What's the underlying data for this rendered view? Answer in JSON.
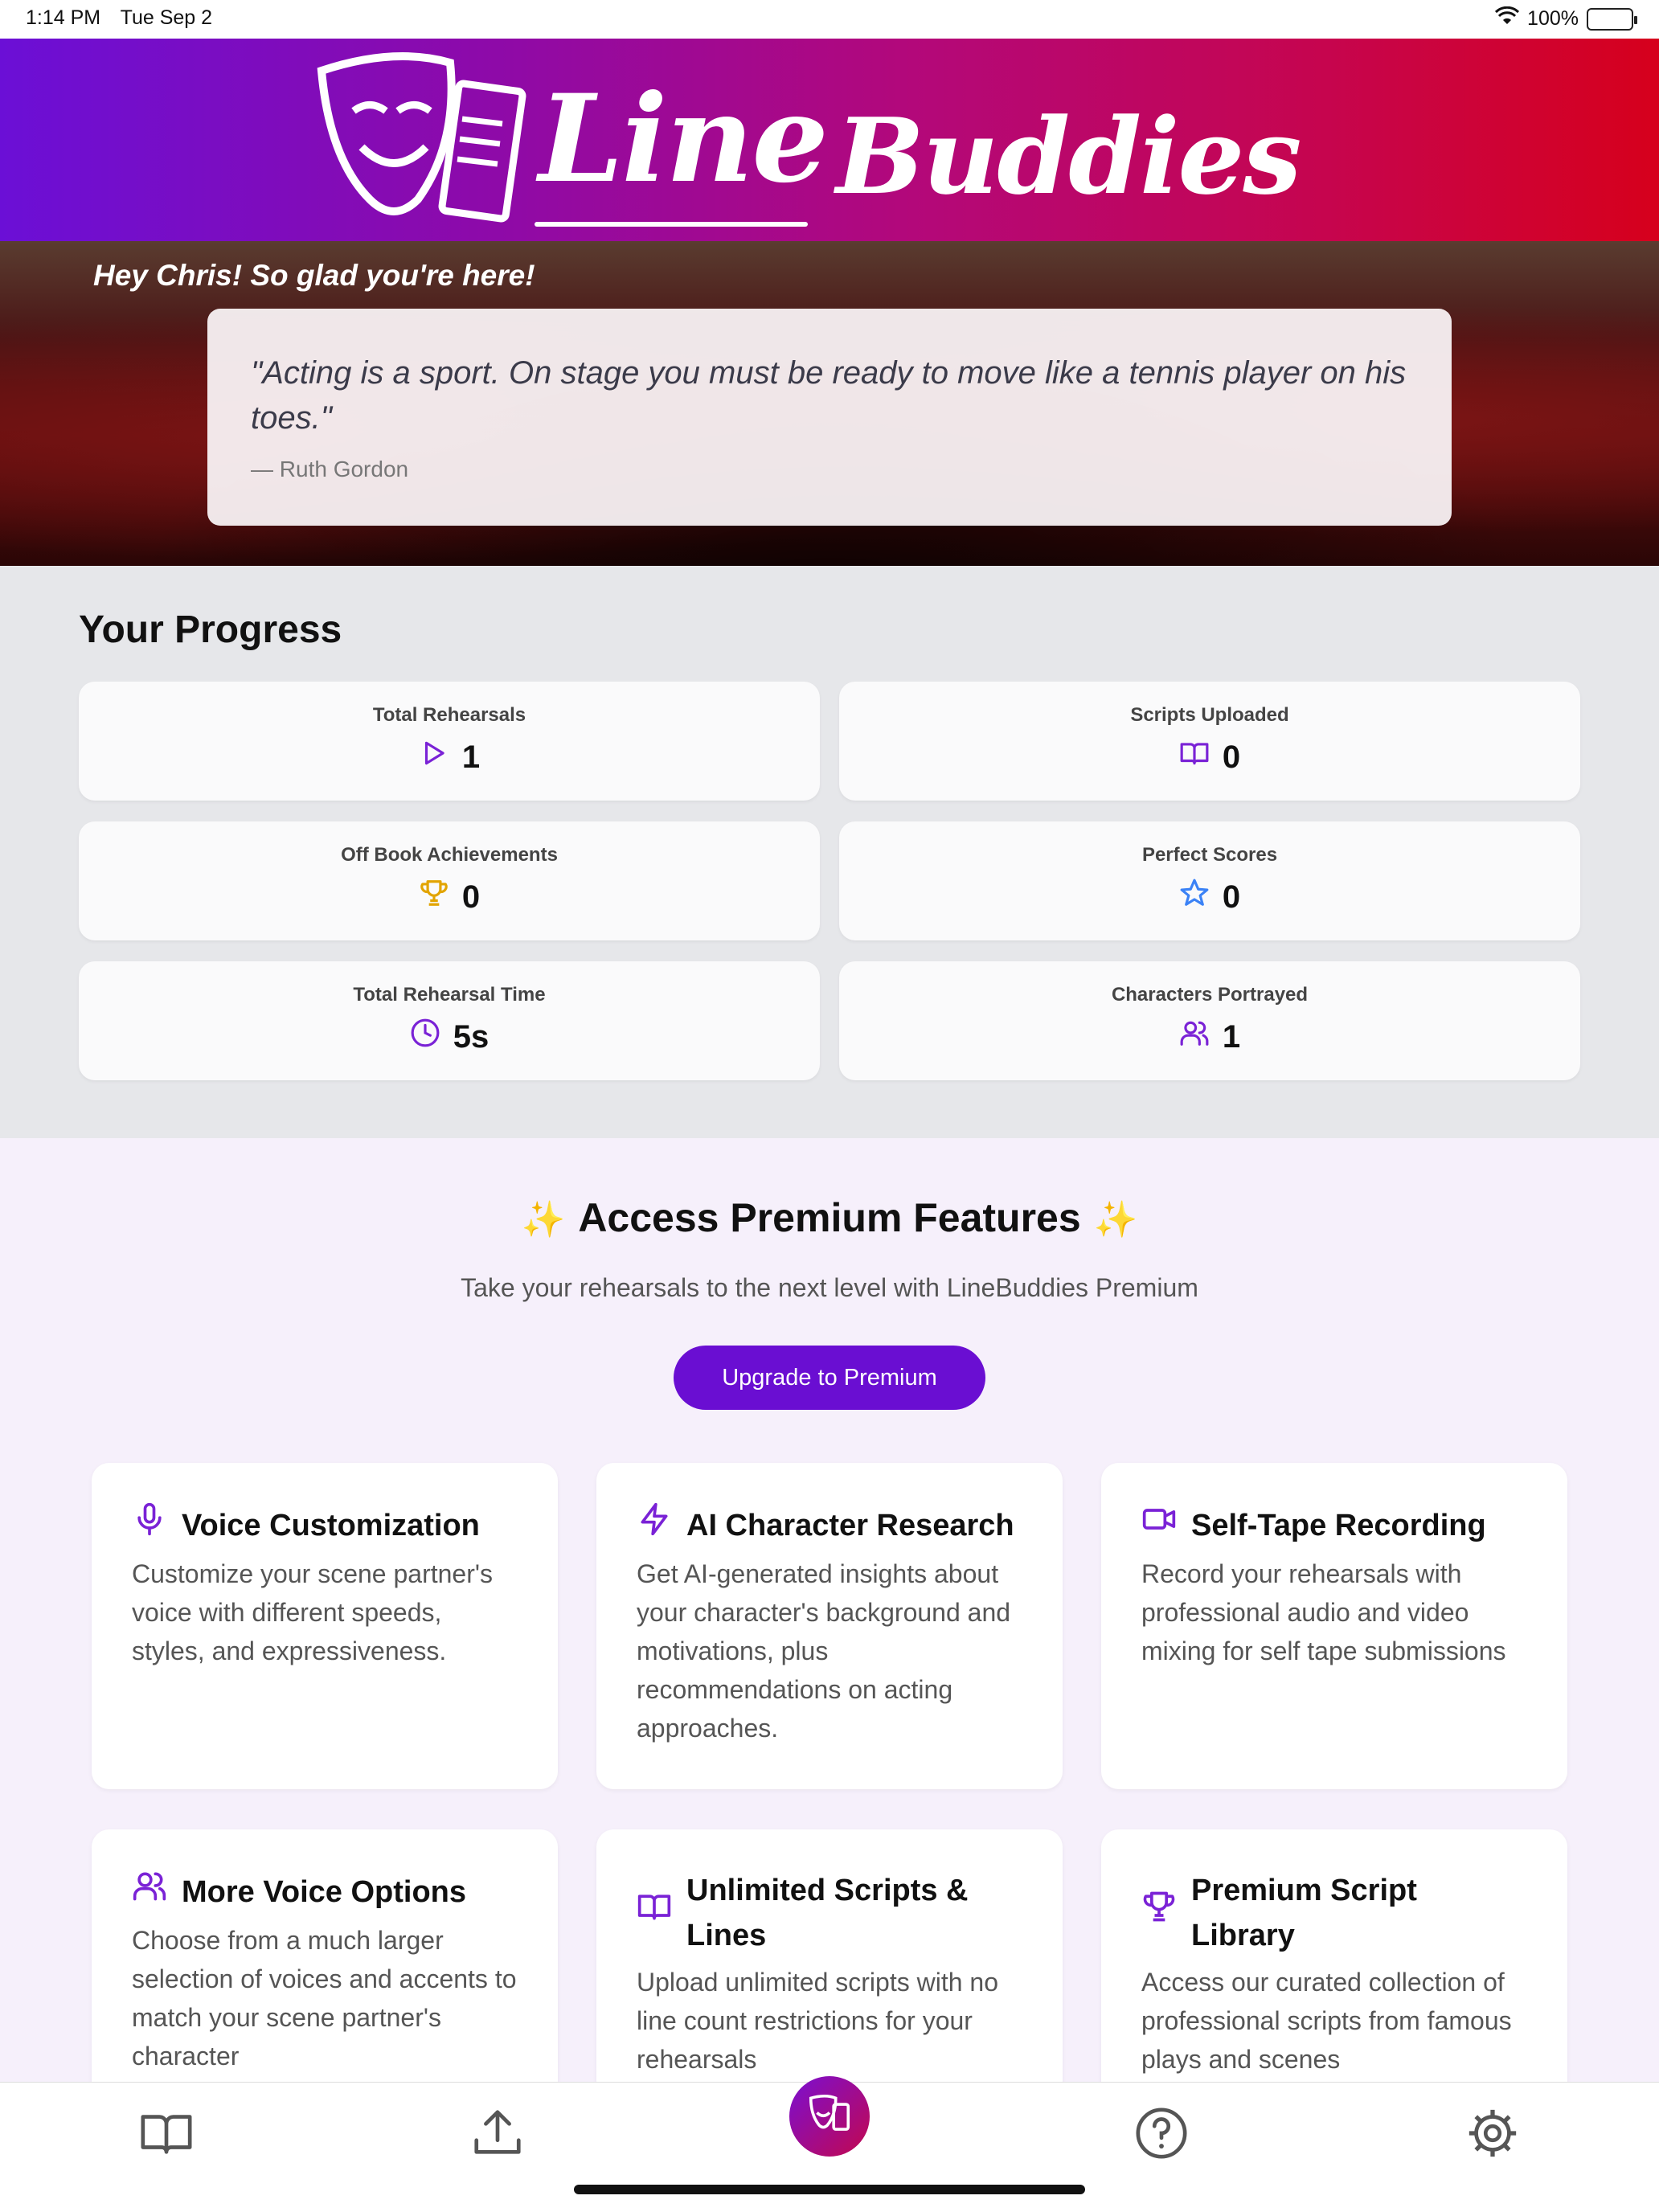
{
  "status_bar": {
    "time": "1:14 PM",
    "date": "Tue Sep 2",
    "battery": "100%"
  },
  "brand": {
    "logo_line": "Line",
    "logo_buddies": "Buddies",
    "gradient_start": "#6b0fd6",
    "gradient_end": "#d6001c"
  },
  "hero": {
    "greeting": "Hey Chris! So glad you're here!",
    "quote": "\"Acting is a sport. On stage you must be ready to move like a tennis player on his toes.\"",
    "author": "— Ruth Gordon"
  },
  "progress": {
    "title": "Your Progress",
    "stats": [
      {
        "label": "Total Rehearsals",
        "value": "1",
        "icon": "play-icon"
      },
      {
        "label": "Scripts Uploaded",
        "value": "0",
        "icon": "book-icon"
      },
      {
        "label": "Off Book Achievements",
        "value": "0",
        "icon": "trophy-icon"
      },
      {
        "label": "Perfect Scores",
        "value": "0",
        "icon": "star-icon"
      },
      {
        "label": "Total Rehearsal Time",
        "value": "5s",
        "icon": "clock-icon"
      },
      {
        "label": "Characters Portrayed",
        "value": "1",
        "icon": "users-icon"
      }
    ]
  },
  "premium": {
    "title": "Access Premium Features",
    "sparkle": "✨",
    "subtitle": "Take your rehearsals to the next level with LineBuddies Premium",
    "button": "Upgrade to Premium",
    "accent": "#6a0ed2",
    "features": [
      {
        "title": "Voice Customization",
        "desc": "Customize your scene partner's voice with different speeds, styles, and expressiveness.",
        "icon": "microphone-icon"
      },
      {
        "title": "AI Character Research",
        "desc": "Get AI-generated insights about your character's background and motivations, plus recommendations on acting approaches.",
        "icon": "lightning-icon"
      },
      {
        "title": "Self-Tape Recording",
        "desc": "Record your rehearsals with professional audio and video mixing for self tape submissions",
        "icon": "video-camera-icon"
      },
      {
        "title": "More Voice Options",
        "desc": "Choose from a much larger selection of voices and accents to match your scene partner's character",
        "icon": "users-icon"
      },
      {
        "title": "Unlimited Scripts & Lines",
        "desc": "Upload unlimited scripts with no line count restrictions for your rehearsals",
        "icon": "book-icon"
      },
      {
        "title": "Premium Script Library",
        "desc": "Access our curated collection of professional scripts from famous plays and scenes",
        "icon": "trophy-icon"
      }
    ]
  },
  "tabbar": {
    "items": [
      "library-tab",
      "upload-tab",
      "rehearse-tab",
      "help-tab",
      "settings-tab"
    ]
  }
}
